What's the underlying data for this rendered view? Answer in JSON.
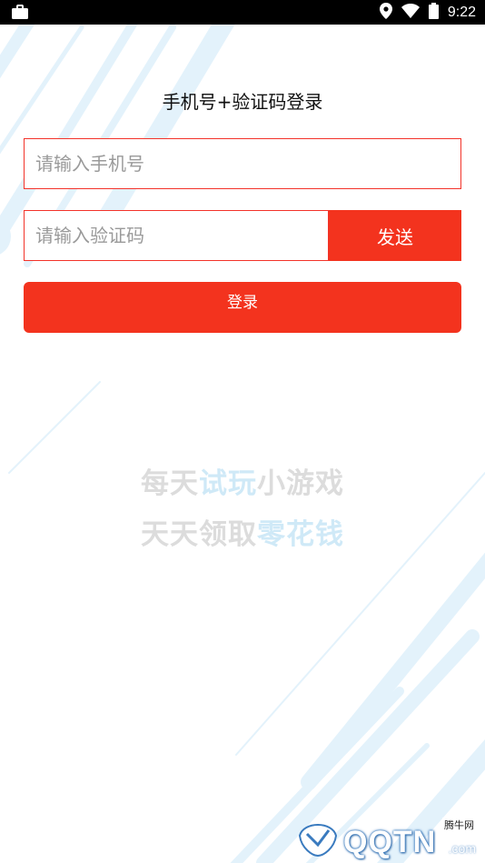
{
  "status_bar": {
    "time": "9:22",
    "icons": [
      "briefcase-icon",
      "location-icon",
      "wifi-icon",
      "battery-icon"
    ]
  },
  "page": {
    "title": "手机号+验证码登录"
  },
  "form": {
    "phone_placeholder": "请输入手机号",
    "phone_value": "",
    "code_placeholder": "请输入验证码",
    "code_value": "",
    "send_label": "发送",
    "login_label": "登录"
  },
  "slogan": {
    "line1_a": "每天",
    "line1_b": "试玩",
    "line1_c": "小游戏",
    "line2_a": "天天领取",
    "line2_b": "零花钱"
  },
  "watermark": {
    "brand_cn": "腾牛网",
    "brand": "QQTN",
    "domain": ".com"
  },
  "colors": {
    "accent_red": "#f3331e",
    "border_red": "#f3332a",
    "decor_blue": "#e3f2fb",
    "slogan_gray": "#dcdcdc",
    "slogan_highlight": "#cfe9f7"
  }
}
